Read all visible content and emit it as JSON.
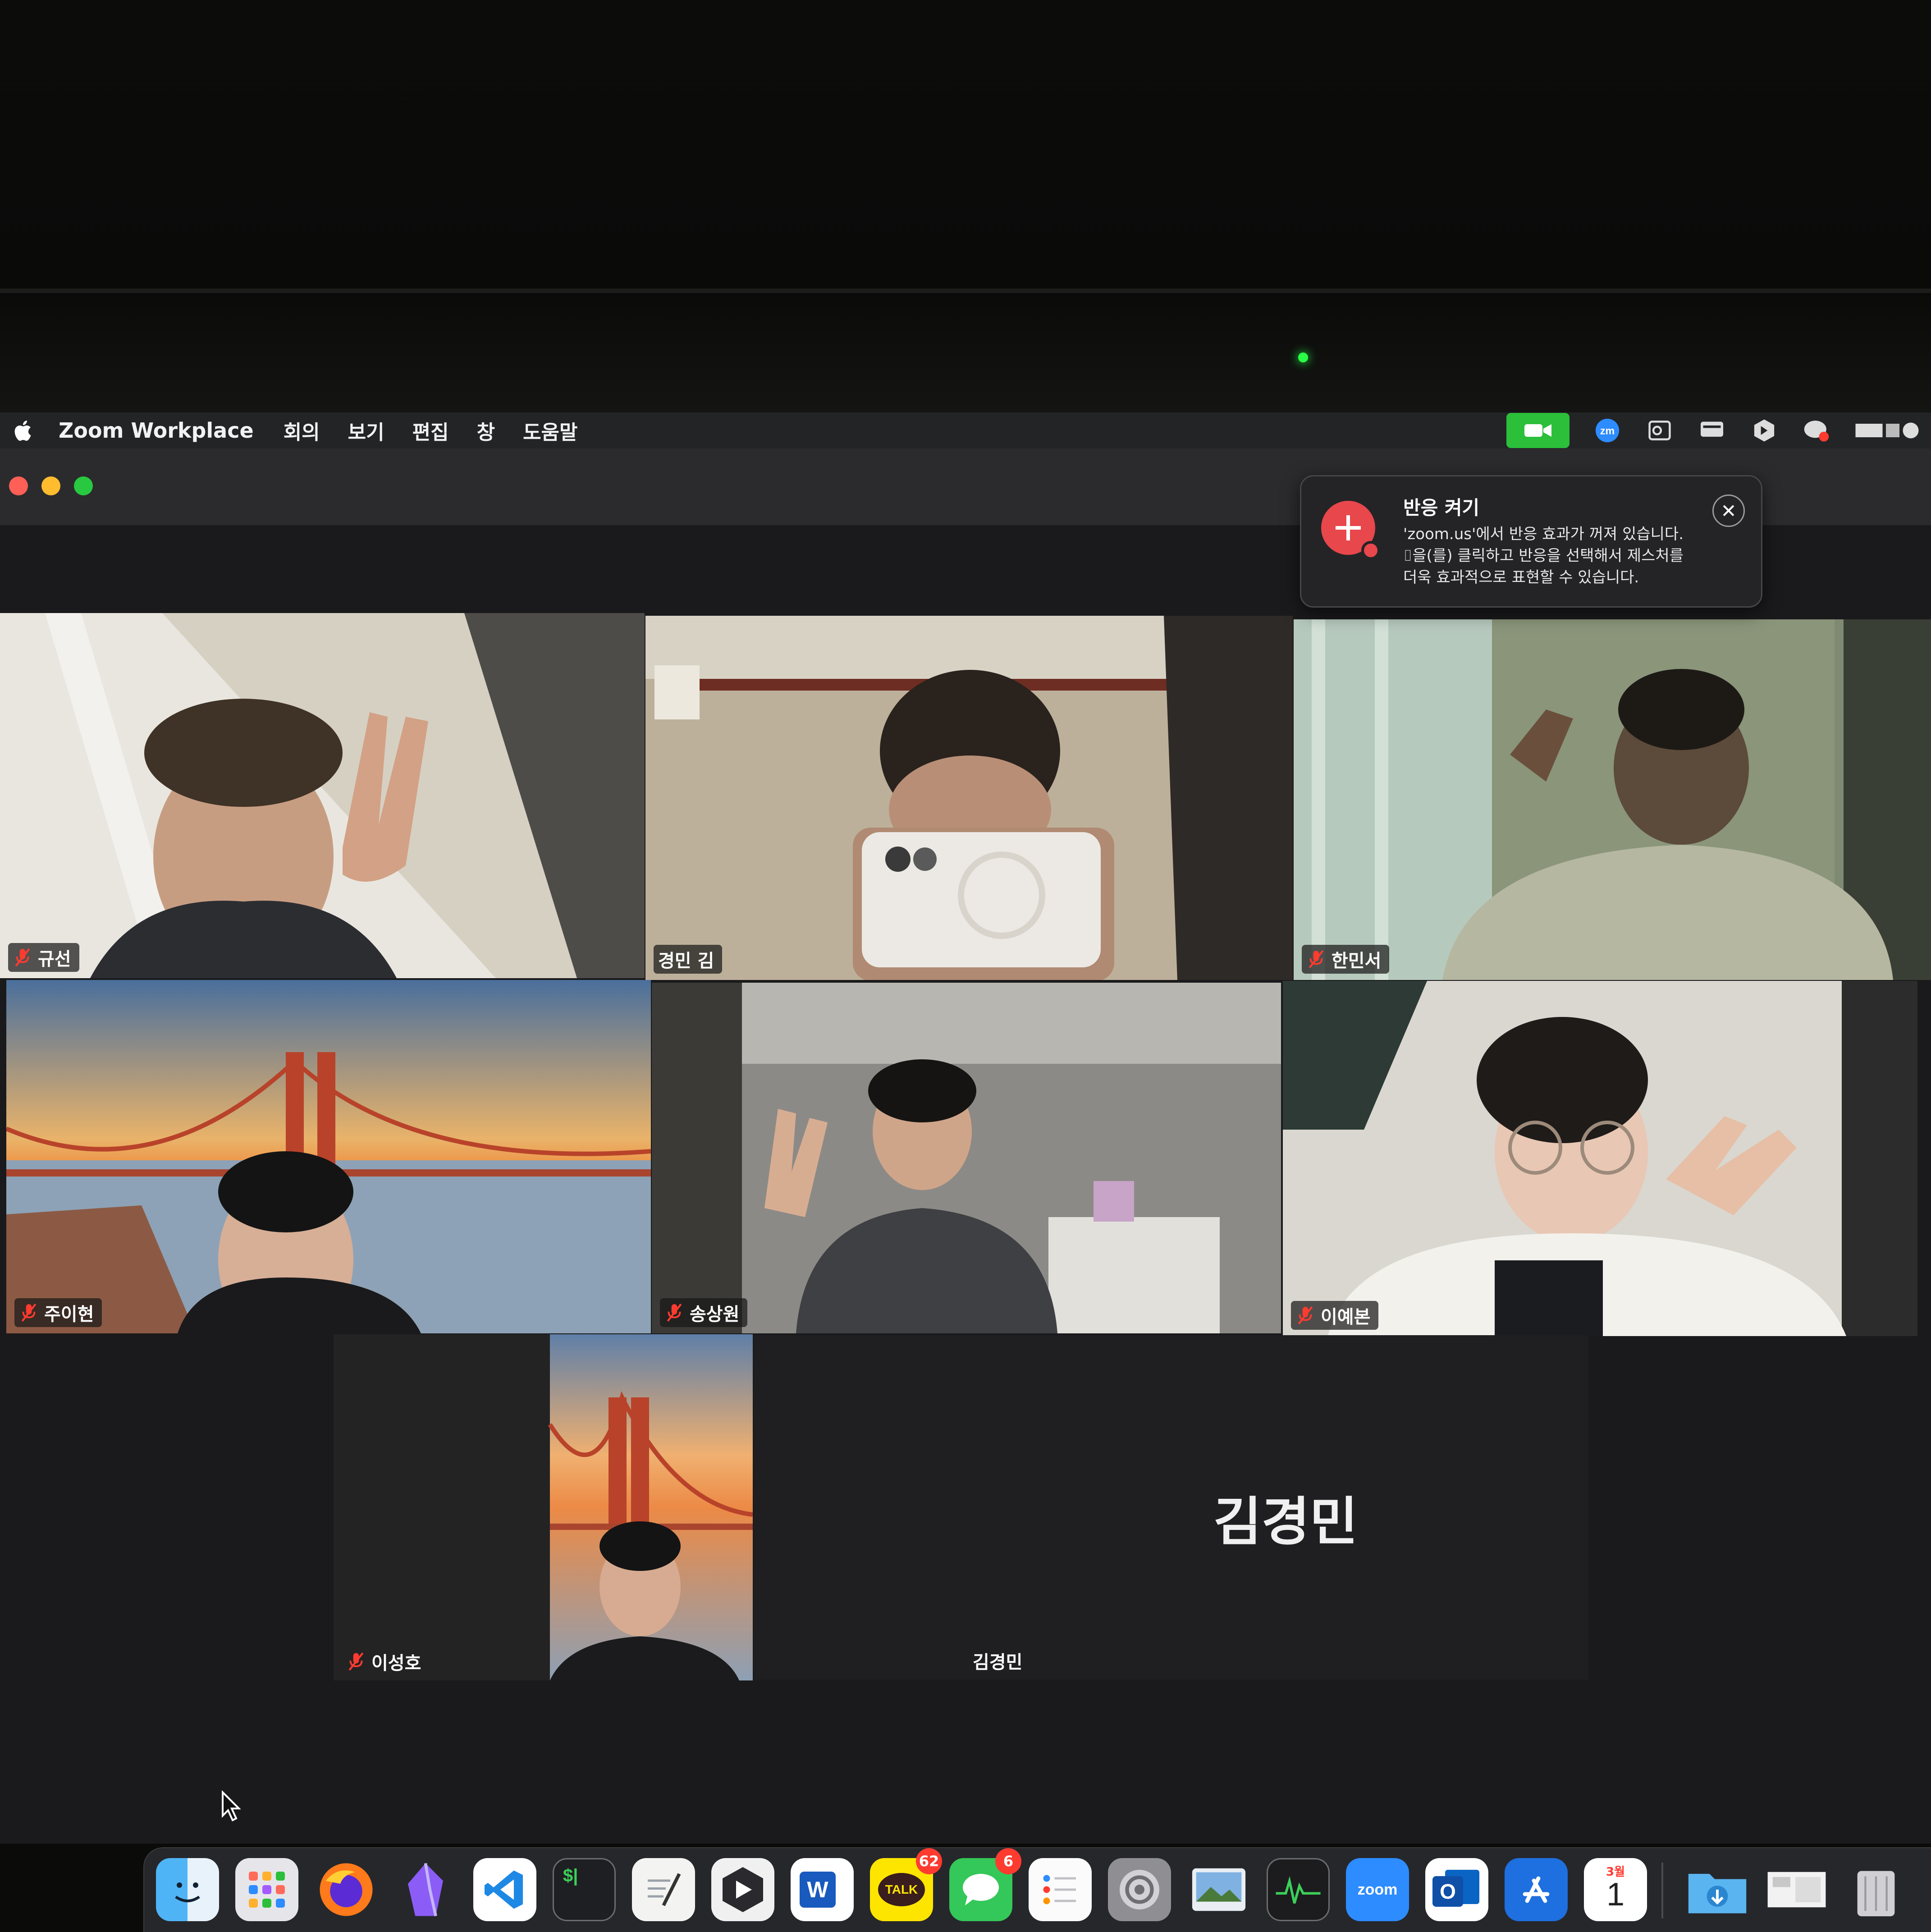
{
  "menubar": {
    "app_name": "Zoom Workplace",
    "menus": [
      "회의",
      "보기",
      "편집",
      "창",
      "도움말"
    ]
  },
  "notification": {
    "title": "반응 켜기",
    "lines": [
      "'zoom.us'에서 반응 효과가 꺼져 있습니다.",
      "⌷을(를) 클릭하고 반응을 선택해서 제스처를",
      "더욱 효과적으로 표현할 수 있습니다."
    ],
    "close_glyph": "✕"
  },
  "participants": [
    {
      "name": "규선",
      "muted": true
    },
    {
      "name": "경민 김",
      "muted": false,
      "active_speaker": true
    },
    {
      "name": "한민서",
      "muted": true
    },
    {
      "name": "주이현",
      "muted": true
    },
    {
      "name": "송상원",
      "muted": true
    },
    {
      "name": "이예본 ",
      "muted": true
    },
    {
      "name": "이성호",
      "muted": true
    },
    {
      "name": "김경민",
      "muted": false,
      "camera_off": true,
      "display_name": "김경민"
    }
  ],
  "dock": {
    "items": [
      {
        "icon": "finder-icon",
        "label": ""
      },
      {
        "icon": "launchpad-icon",
        "label": ""
      },
      {
        "icon": "firefox-icon",
        "label": ""
      },
      {
        "icon": "obsidian-icon",
        "label": ""
      },
      {
        "icon": "vscode-icon",
        "label": ""
      },
      {
        "icon": "terminal-icon",
        "label": "$|"
      },
      {
        "icon": "textedit-icon",
        "label": ""
      },
      {
        "icon": "cursor-app-icon",
        "label": ""
      },
      {
        "icon": "word-icon",
        "label": "W"
      },
      {
        "icon": "kakaotalk-icon",
        "label": "TALK",
        "badge": "62"
      },
      {
        "icon": "messages-icon",
        "label": "",
        "badge": "6"
      },
      {
        "icon": "reminders-icon",
        "label": ""
      },
      {
        "icon": "system-settings-icon",
        "label": ""
      },
      {
        "icon": "preview-icon",
        "label": ""
      },
      {
        "icon": "activity-monitor-icon",
        "label": ""
      },
      {
        "icon": "zoom-icon",
        "label": "zoom"
      },
      {
        "icon": "outlook-icon",
        "label": "O"
      },
      {
        "icon": "app-store-icon",
        "label": ""
      },
      {
        "icon": "calendar-icon",
        "label": "1",
        "month": "3월"
      },
      {
        "icon": "downloads-folder-icon",
        "label": ""
      },
      {
        "icon": "screenshot-thumb-icon",
        "label": ""
      },
      {
        "icon": "trash-icon",
        "label": ""
      }
    ]
  },
  "colors": {
    "active_speaker_border": "#7dd84e",
    "zoom_status_green": "#2bbf3a",
    "camera_led": "#28ff46",
    "notification_icon": "#e8474c"
  }
}
